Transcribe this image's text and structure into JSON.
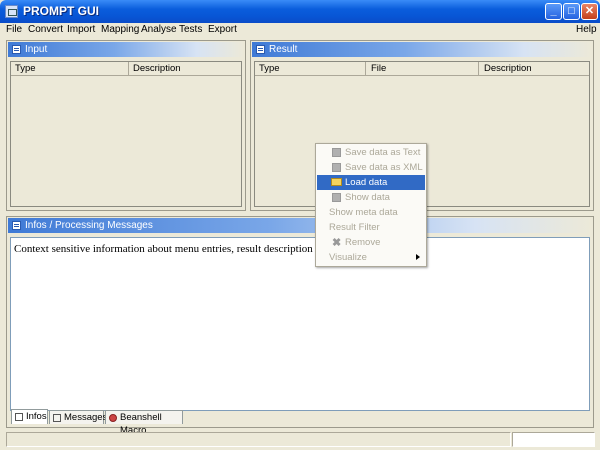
{
  "window": {
    "title": "PROMPT GUI",
    "minimize": "_",
    "maximize": "□",
    "close": "✕"
  },
  "menubar": {
    "left": [
      "File",
      "Convert",
      "Import",
      "Mapping",
      "Analyse",
      "Tests",
      "Export"
    ],
    "right": "Help"
  },
  "input_panel": {
    "title": "Input",
    "columns": [
      "Type",
      "Description"
    ]
  },
  "result_panel": {
    "title": "Result",
    "columns": [
      "Type",
      "File",
      "Description"
    ]
  },
  "info_panel": {
    "title": "Infos / Processing Messages",
    "text": "Context sensitive information about menu entries, result description or f",
    "tabs": [
      "Infos",
      "Messages",
      "Beanshell Macro"
    ],
    "active_tab": "Infos"
  },
  "context_menu": {
    "items": [
      {
        "label": "Save data as Text",
        "icon": "save-icon",
        "enabled": false
      },
      {
        "label": "Save data as XML",
        "icon": "save-icon",
        "enabled": false
      },
      {
        "label": "Load data",
        "icon": "folder-open-icon",
        "enabled": true,
        "highlighted": true
      },
      {
        "label": "Show data",
        "icon": "data-icon",
        "enabled": false
      },
      {
        "label": "Show meta data",
        "icon": "",
        "enabled": false
      },
      {
        "label": "Result Filter",
        "icon": "",
        "enabled": false
      },
      {
        "label": "Remove",
        "icon": "remove-icon",
        "enabled": false
      },
      {
        "label": "Visualize",
        "icon": "",
        "enabled": false,
        "submenu": true
      }
    ]
  },
  "colors": {
    "titlebar": "#0a5ddc",
    "highlight": "#316ac5",
    "background": "#ece9d8"
  }
}
